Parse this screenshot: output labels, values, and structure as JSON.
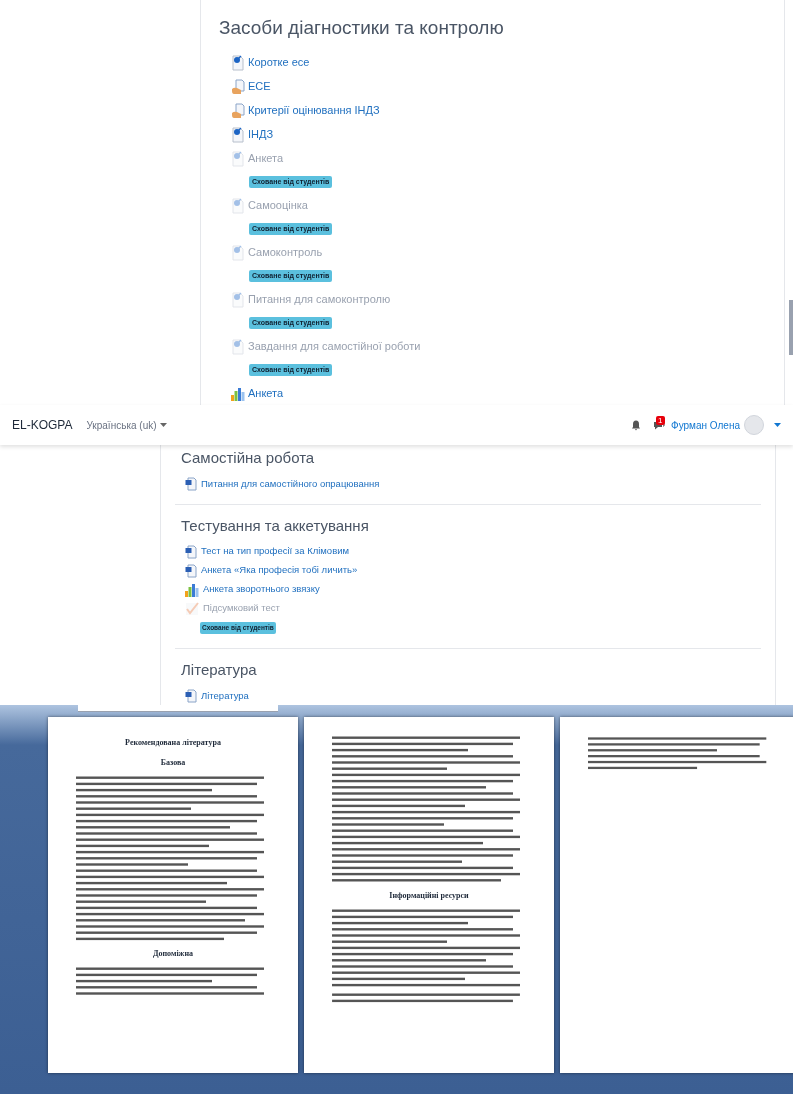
{
  "diagnostics_section": {
    "title": "Засоби діагностики та контролю",
    "items": [
      {
        "kind": "assign",
        "label": "Коротке есе",
        "hidden": false
      },
      {
        "kind": "resource",
        "label": "ЕСЕ",
        "hidden": false
      },
      {
        "kind": "resource",
        "label": "Критерії оцінювання ІНДЗ",
        "hidden": false
      },
      {
        "kind": "assign",
        "label": "ІНДЗ",
        "hidden": false
      },
      {
        "kind": "assign",
        "label": "Анкета",
        "hidden": true,
        "badge": "Сховане від студентів"
      },
      {
        "kind": "assign",
        "label": "Самооцінка",
        "hidden": true,
        "badge": "Сховане від студентів"
      },
      {
        "kind": "assign",
        "label": "Самоконтроль",
        "hidden": true,
        "badge": "Сховане від студентів"
      },
      {
        "kind": "assign",
        "label": "Питання для самоконтролю",
        "hidden": true,
        "badge": "Сховане від студентів"
      },
      {
        "kind": "assign",
        "label": "Завдання для самостійної роботи",
        "hidden": true,
        "badge": "Сховане від студентів"
      },
      {
        "kind": "feedback",
        "label": "Анкета",
        "hidden": false
      }
    ]
  },
  "navbar": {
    "brand": "EL-KOGPA",
    "language": "Українська (uk)",
    "message_count": "1",
    "user_name": "Фурман Олена"
  },
  "sections": [
    {
      "title": "Самостійна робота",
      "items": [
        {
          "kind": "word",
          "label": "Питання для самостійного опрацювання",
          "hidden": false
        }
      ]
    },
    {
      "title": "Тестування та аккетування",
      "items": [
        {
          "kind": "word",
          "label": "Тест на тип професії за Клімовим",
          "hidden": false
        },
        {
          "kind": "word",
          "label": "Анкета «Яка професія тобі личить»",
          "hidden": false
        },
        {
          "kind": "feedback",
          "label": "Анкета зворотнього звязку",
          "hidden": false
        },
        {
          "kind": "quiz",
          "label": "Підсумковий тест",
          "hidden": true,
          "badge": "Сховане від студентів"
        }
      ]
    },
    {
      "title": "Література",
      "items": [
        {
          "kind": "word",
          "label": "Література",
          "hidden": false
        }
      ]
    }
  ],
  "document_pages": [
    {
      "blocks": [
        {
          "kind": "title",
          "text": "Рекомендована література"
        },
        {
          "kind": "heading",
          "text": "Базова"
        },
        {
          "kind": "text"
        },
        {
          "kind": "heading",
          "text": "Допоміжна"
        },
        {
          "kind": "text"
        }
      ]
    },
    {
      "blocks": [
        {
          "kind": "text"
        },
        {
          "kind": "heading",
          "text": "Інформаційні ресурси"
        },
        {
          "kind": "text"
        },
        {
          "kind": "text"
        }
      ]
    },
    {
      "blocks": [
        {
          "kind": "text"
        }
      ]
    }
  ]
}
